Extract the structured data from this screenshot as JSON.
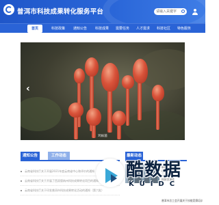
{
  "header": {
    "title": "普洱市科技成果转化服务平台",
    "search_placeholder": "请输入关键字"
  },
  "nav": {
    "items": [
      {
        "label": "首页",
        "active": true
      },
      {
        "label": "科技政策",
        "active": false
      },
      {
        "label": "通知公告",
        "active": false
      },
      {
        "label": "科技成果",
        "active": false
      },
      {
        "label": "需要任务",
        "active": false
      },
      {
        "label": "人才需求",
        "active": false
      },
      {
        "label": "科技社区",
        "active": false
      },
      {
        "label": "特色服务",
        "active": false
      }
    ]
  },
  "hero": {
    "prev_arrow": "‹",
    "caption": "鸡枞菌"
  },
  "notices": {
    "tab_active": "通知公告",
    "tab_inactive": "工作动态",
    "items": [
      "云南省科技厅关于开展2021年度云南省中心和评价的通知",
      "云南省科技厅关于开展了西双版纳州科技成果转化项目的通知",
      "云南省科技厅关于印发普洱市科技成果转化活动的通知（第六批）"
    ]
  },
  "news": {
    "tab": "最新动态",
    "side_lines": [
      "新闻",
      "项目推荐会",
      "云南·昆明",
      "科技交流会"
    ],
    "bottom_line": "普洱市总工会开展关于技能竞赛培训"
  },
  "watermark": {
    "title": "酷数据",
    "subtitle": "KUIDC"
  },
  "colors": {
    "brand": "#2a63d6",
    "header": "#1f56c9",
    "tab_inactive": "#8fb0ea"
  }
}
